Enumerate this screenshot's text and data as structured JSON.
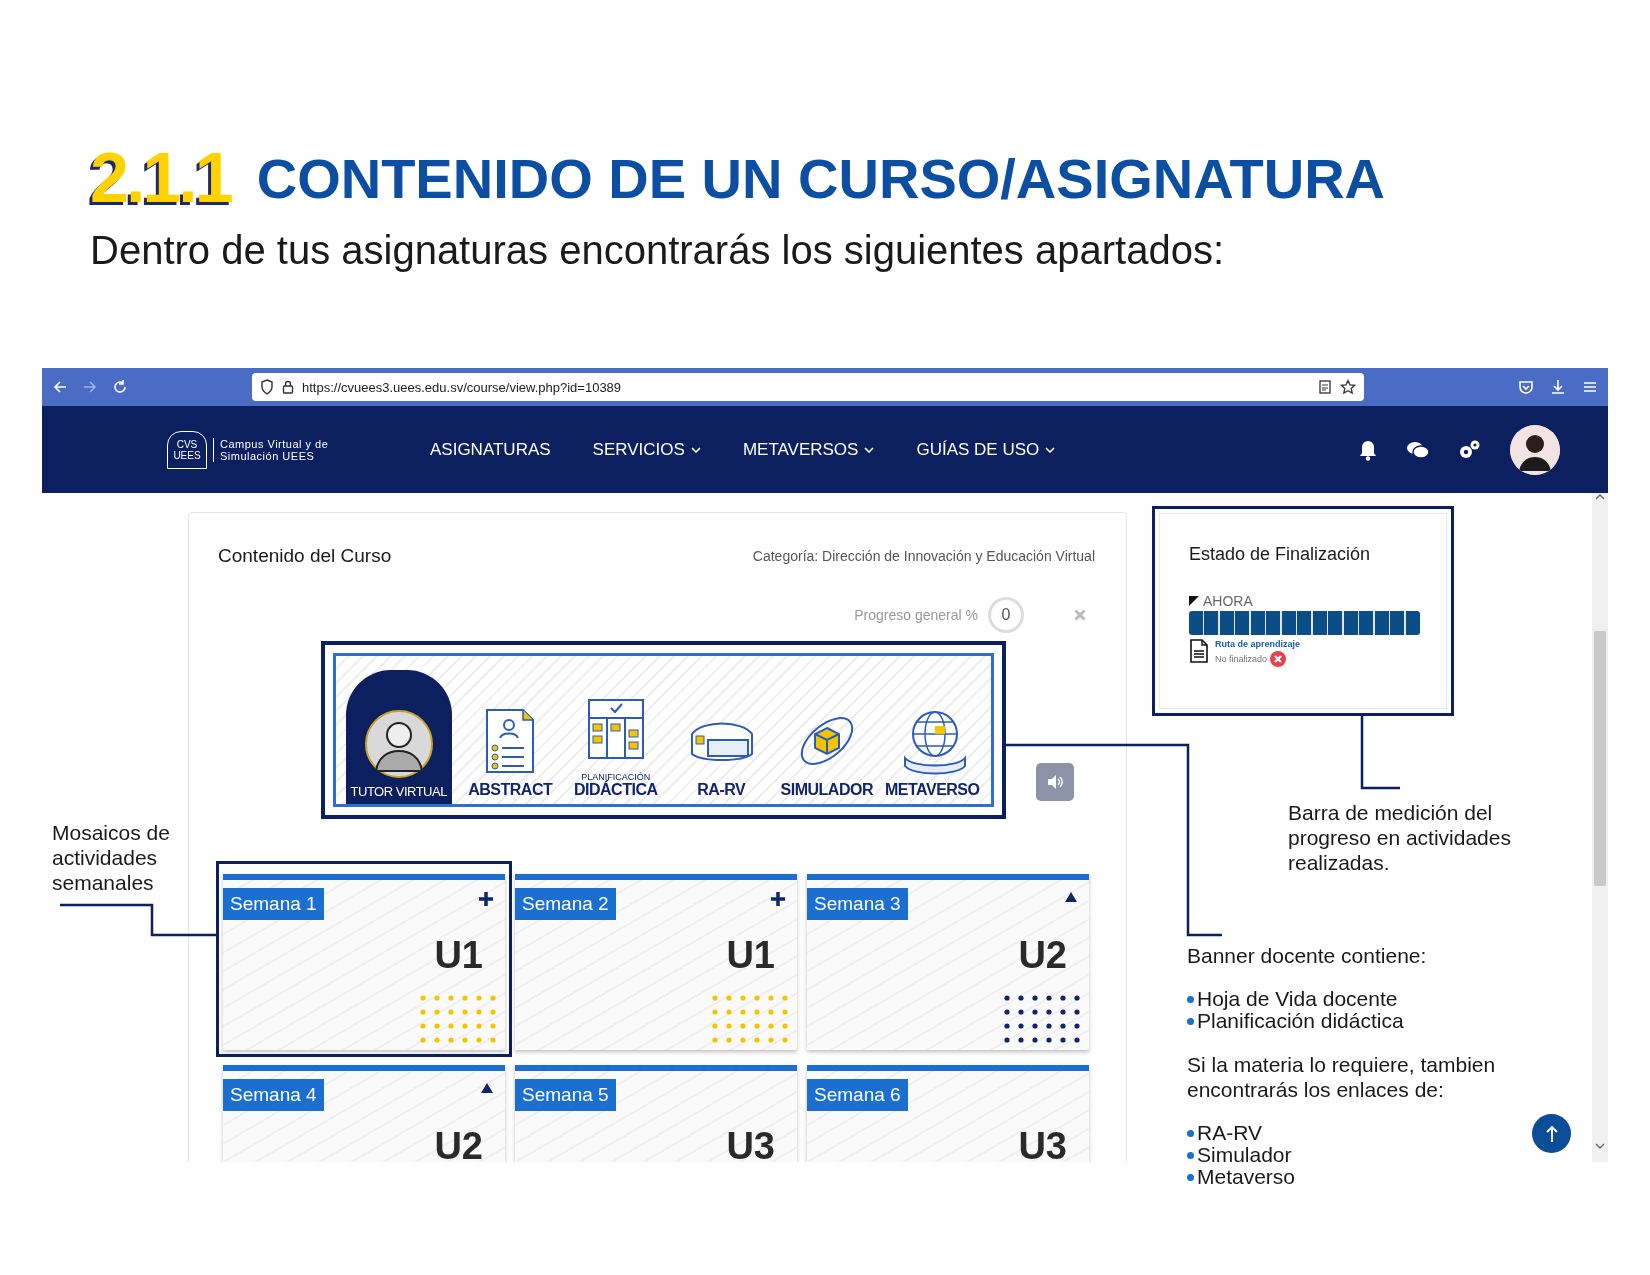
{
  "heading": {
    "number": "2.1.1",
    "title": "CONTENIDO DE UN CURSO/ASIGNATURA"
  },
  "intro": "Dentro de tus asignaturas encontrarás los siguientes apartados:",
  "browser": {
    "url": "https://cvuees3.uees.edu.sv/course/view.php?id=10389"
  },
  "site": {
    "logo_mark_top": "CVS",
    "logo_mark_bottom": "UEES",
    "logo_text": "Campus Virtual y de Simulación UEES",
    "menu": [
      {
        "label": "ASIGNATURAS",
        "dropdown": false
      },
      {
        "label": "SERVICIOS",
        "dropdown": true
      },
      {
        "label": "METAVERSOS",
        "dropdown": true
      },
      {
        "label": "GUÍAS DE USO",
        "dropdown": true
      }
    ]
  },
  "course": {
    "title": "Contenido del Curso",
    "category": "Categoría: Dirección de Innovación y Educación Virtual",
    "progress_label": "Progreso general %",
    "progress_value": "0",
    "banner": [
      {
        "kind": "tutor",
        "label": "TUTOR VIRTUAL"
      },
      {
        "kind": "document",
        "label": "ABSTRACT"
      },
      {
        "kind": "planner",
        "overline": "PLANIFICACIÓN",
        "label": "DIDÁCTICA"
      },
      {
        "kind": "headset",
        "label": "RA-RV"
      },
      {
        "kind": "cube",
        "label": "SIMULADOR"
      },
      {
        "kind": "globe",
        "label": "METAVERSO"
      }
    ],
    "weeks": [
      {
        "label": "Semana 1",
        "unit": "U1",
        "kind": "plus",
        "highlighted": true
      },
      {
        "label": "Semana 2",
        "unit": "U1",
        "kind": "plus",
        "highlighted": false
      },
      {
        "label": "Semana 3",
        "unit": "U2",
        "kind": "triangle",
        "highlighted": false
      },
      {
        "label": "Semana 4",
        "unit": "U2",
        "kind": "triangle",
        "highlighted": false
      },
      {
        "label": "Semana 5",
        "unit": "U3",
        "kind": "plain",
        "highlighted": false
      },
      {
        "label": "Semana 6",
        "unit": "U3",
        "kind": "plain",
        "highlighted": false
      }
    ]
  },
  "completion": {
    "title": "Estado de Finalización",
    "section": "AHORA",
    "level": 1,
    "activity": "Ruta de aprendizaje",
    "status": "No finalizado",
    "completed": false
  },
  "annotations": {
    "tiles": "Mosaicos de actividades semanales",
    "progress_bar": "Barra de medición del progreso en actividades realizadas.",
    "banner": {
      "intro": "Banner docente contiene:",
      "items": [
        "Hoja de Vida docente",
        "Planificación didáctica"
      ],
      "note": "Si la materia lo requiere, tambien encontrarás los enlaces de:",
      "links": [
        "RA-RV",
        "Simulador",
        "Metaverso"
      ]
    }
  }
}
